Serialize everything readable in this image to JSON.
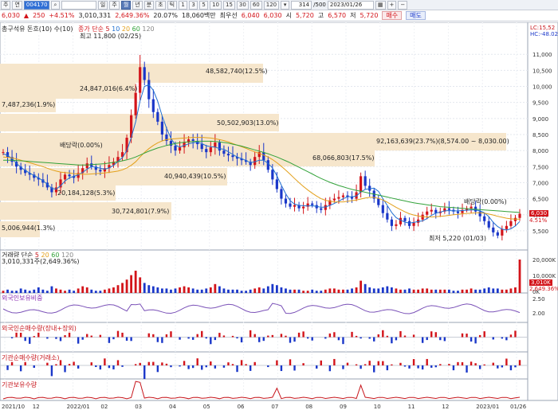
{
  "toolbar": {
    "buttons": [
      "주",
      "연"
    ],
    "code": "004170",
    "name": "",
    "period_buttons": [
      "일",
      "주",
      "월",
      "년",
      "분",
      "초",
      "틱"
    ],
    "interval_buttons": [
      "1",
      "3",
      "5",
      "10",
      "15",
      "30",
      "60",
      "120"
    ],
    "count_value": "314",
    "count_total": "/500",
    "date_value": "2023/01/26"
  },
  "quote": {
    "price": "6,030",
    "change": "250",
    "change_pct": "+4.51%",
    "volume": "3,010,331",
    "volume_pct": "2,649.36%",
    "turnover_pct": "20.07%",
    "amount": "18,060백만",
    "prev_label": "최우선",
    "prev_ask": "6,040",
    "prev_bid": "6,030",
    "open_label": "시",
    "open": "5,720",
    "high_label": "고",
    "high": "6,570",
    "low_label": "저",
    "low": "5,720",
    "buy_label": "매수",
    "sell_label": "매도"
  },
  "price_panel": {
    "legend_left": "총구석유 돈흐(10) 수(10)",
    "legend_ma": "종가 단순",
    "ma_periods": [
      "5",
      "10",
      "20",
      "60",
      "120"
    ],
    "high_note": "최고 11,800 (02/25)",
    "low_note": "최저 5,220 (01/03)",
    "lc": "LC:15,52",
    "hc": "HC:-48.02",
    "current_price": "6,030",
    "current_pct": "4.51%",
    "dividend_notes": [
      "배당락(0.00%)",
      "배당락(0.00%)"
    ],
    "volume_profile": [
      "48,582,740(12.5%)",
      "24,847,016(6.4%)",
      "7,487,236(1.9%)",
      "50,502,903(13.0%)",
      "92,163,639(23.7%)(8,574.00 ~ 8,030.00)",
      "68,066,803(17.5%)",
      "40,940,439(10.5%)",
      "20,184,128(5.3%)",
      "30,724,801(7.9%)",
      "5,006,944(1.3%)"
    ]
  },
  "volume_panel": {
    "legend": "거래량 단순",
    "ma_periods": [
      "5",
      "20",
      "60",
      "120"
    ],
    "current": "3,010,331주(2,649.36%)",
    "current_tag": "3,010K",
    "current_tag2": "2,649.36%"
  },
  "foreign_panel": {
    "legend": "외국인보유비중"
  },
  "foreign_net_panel": {
    "legend": "외국인순매수량(장내+장외)"
  },
  "inst_net_panel": {
    "legend": "기관순매수량(거래소)"
  },
  "inst_hold_panel": {
    "legend": "기관보유수량"
  },
  "chart_data": {
    "type": "line",
    "title": "",
    "price_axis": {
      "ticks": [
        "11,000",
        "10,500",
        "10,000",
        "9,500",
        "9,000",
        "8,500",
        "8,000",
        "7,500",
        "7,000",
        "6,500",
        "6,000",
        "5,500"
      ],
      "ylim": [
        5000,
        11800
      ]
    },
    "volume_axis": {
      "ticks": [
        "20,000K",
        "10,000K",
        "0K"
      ]
    },
    "foreign_axis": {
      "ticks": [
        "2.50",
        "2.00"
      ]
    },
    "x_axis": {
      "ticks": [
        "2021/10",
        "12",
        "2022/01",
        "02",
        "03",
        "04",
        "05",
        "06",
        "07",
        "08",
        "09",
        "10",
        "11",
        "12",
        "2023/01",
        "01/26"
      ]
    },
    "series": [
      {
        "name": "종가",
        "values": [
          7950,
          7800,
          7650,
          7500,
          7400,
          7300,
          7250,
          7150,
          7100,
          7000,
          6850,
          6700,
          6850,
          7100,
          7250,
          7200,
          7150,
          7300,
          7450,
          7600,
          7500,
          7400,
          7350,
          7450,
          7550,
          7650,
          7800,
          7950,
          8400,
          9100,
          9800,
          10600,
          10200,
          9600,
          9200,
          8900,
          8500,
          8300,
          8150,
          8000,
          8100,
          8250,
          8350,
          8300,
          8200,
          8050,
          7950,
          8100,
          8250,
          8000,
          7900,
          7850,
          7800,
          7750,
          7700,
          7650,
          7550,
          7800,
          7950,
          7700,
          7400,
          7100,
          6800,
          6500,
          6350,
          6250,
          6300,
          6200,
          6250,
          6350,
          6300,
          6200,
          6150,
          6300,
          6450,
          6500,
          6550,
          6600,
          6550,
          6500,
          6700,
          7200,
          6900,
          6750,
          6500,
          6300,
          6050,
          5850,
          5650,
          5700,
          5900,
          5800,
          5650,
          5750,
          5850,
          6000,
          6100,
          6150,
          6050,
          6100,
          6200,
          6150,
          6100,
          6050,
          6150,
          6200,
          6250,
          6100,
          5950,
          5800,
          5600,
          5450,
          5350,
          5550,
          5650,
          5800,
          5900,
          6030
        ]
      },
      {
        "name": "5",
        "values": [
          7900,
          7850,
          7750,
          7600,
          7480,
          7380,
          7300,
          7220,
          7150,
          7060,
          6950,
          6820,
          6800,
          6900,
          7050,
          7150,
          7200,
          7240,
          7320,
          7420,
          7500,
          7480,
          7450,
          7420,
          7460,
          7540,
          7660,
          7780,
          8000,
          8400,
          8900,
          9550,
          10000,
          10050,
          9880,
          9540,
          9080,
          8700,
          8380,
          8170,
          8110,
          8160,
          8210,
          8240,
          8260,
          8220,
          8150,
          8120,
          8110,
          8060,
          8040,
          7960,
          7880,
          7800,
          7750,
          7690,
          7620,
          7650,
          7700,
          7700,
          7600,
          7460,
          7210,
          6920,
          6650,
          6440,
          6330,
          6290,
          6280,
          6270,
          6280,
          6260,
          6230,
          6240,
          6290,
          6350,
          6420,
          6500,
          6560,
          6560,
          6580,
          6710,
          6790,
          6810,
          6830,
          6730,
          6500,
          6290,
          6070,
          5910,
          5830,
          5770,
          5740,
          5760,
          5790,
          5810,
          5880,
          5980,
          6050,
          6080,
          6120,
          6130,
          6120,
          6120,
          6130,
          6140,
          6150,
          6150,
          6120,
          6060,
          5940,
          5760,
          5630,
          5550,
          5520,
          5560,
          5650,
          5790
        ]
      },
      {
        "name": "20",
        "values": [
          7800,
          7790,
          7770,
          7740,
          7700,
          7660,
          7620,
          7580,
          7540,
          7500,
          7450,
          7400,
          7360,
          7330,
          7310,
          7300,
          7280,
          7270,
          7260,
          7260,
          7270,
          7280,
          7290,
          7300,
          7320,
          7340,
          7360,
          7400,
          7460,
          7540,
          7650,
          7800,
          7940,
          8060,
          8160,
          8240,
          8300,
          8340,
          8360,
          8370,
          8380,
          8390,
          8400,
          8410,
          8410,
          8410,
          8400,
          8390,
          8370,
          8340,
          8310,
          8270,
          8220,
          8170,
          8120,
          8070,
          8010,
          7960,
          7910,
          7860,
          7800,
          7720,
          7620,
          7510,
          7390,
          7260,
          7130,
          7000,
          6880,
          6770,
          6670,
          6580,
          6500,
          6450,
          6420,
          6400,
          6400,
          6400,
          6420,
          6440,
          6460,
          6490,
          6520,
          6540,
          6540,
          6510,
          6460,
          6390,
          6310,
          6230,
          6160,
          6090,
          6030,
          5990,
          5960,
          5940,
          5930,
          5930,
          5940,
          5950,
          5960,
          5980,
          6000,
          6010,
          6030,
          6040,
          6050,
          6060,
          6060,
          6050,
          6020,
          5990,
          5950,
          5920,
          5890,
          5870,
          5860,
          5860
        ]
      },
      {
        "name": "60",
        "values": [
          7700,
          7700,
          7700,
          7690,
          7680,
          7670,
          7660,
          7650,
          7640,
          7630,
          7620,
          7610,
          7600,
          7590,
          7580,
          7570,
          7560,
          7550,
          7550,
          7550,
          7560,
          7570,
          7580,
          7590,
          7610,
          7630,
          7650,
          7680,
          7710,
          7750,
          7800,
          7860,
          7920,
          7980,
          8030,
          8080,
          8120,
          8160,
          8190,
          8220,
          8240,
          8260,
          8270,
          8280,
          8290,
          8290,
          8290,
          8290,
          8280,
          8270,
          8250,
          8230,
          8200,
          8170,
          8140,
          8100,
          8060,
          8020,
          7980,
          7940,
          7900,
          7850,
          7800,
          7740,
          7680,
          7620,
          7550,
          7480,
          7410,
          7340,
          7270,
          7200,
          7130,
          7070,
          7010,
          6960,
          6910,
          6870,
          6830,
          6790,
          6760,
          6730,
          6700,
          6670,
          6640,
          6610,
          6580,
          6550,
          6520,
          6490,
          6460,
          6430,
          6400,
          6370,
          6350,
          6330,
          6310,
          6290,
          6270,
          6250,
          6240,
          6230,
          6220,
          6210,
          6200,
          6190,
          6180,
          6170,
          6160,
          6150,
          6140,
          6130,
          6120,
          6110,
          6100,
          6090,
          6080,
          6070
        ]
      }
    ],
    "volume_values": [
      2,
      3,
      2,
      2,
      4,
      3,
      2,
      3,
      5,
      3,
      2,
      6,
      4,
      3,
      2,
      3,
      2,
      4,
      6,
      5,
      3,
      2,
      2,
      3,
      4,
      5,
      7,
      9,
      12,
      16,
      20,
      14,
      9,
      7,
      6,
      5,
      4,
      4,
      3,
      4,
      5,
      6,
      5,
      4,
      3,
      3,
      4,
      5,
      8,
      6,
      4,
      3,
      3,
      3,
      2,
      2,
      3,
      4,
      5,
      4,
      6,
      8,
      7,
      5,
      4,
      3,
      3,
      3,
      2,
      2,
      3,
      2,
      2,
      3,
      4,
      4,
      3,
      3,
      3,
      4,
      5,
      11,
      8,
      5,
      4,
      4,
      5,
      6,
      5,
      4,
      3,
      3,
      4,
      3,
      3,
      4,
      4,
      3,
      3,
      3,
      3,
      3,
      2,
      2,
      3,
      3,
      4,
      3,
      3,
      4,
      5,
      4,
      4,
      3,
      3,
      4,
      5,
      30
    ]
  }
}
